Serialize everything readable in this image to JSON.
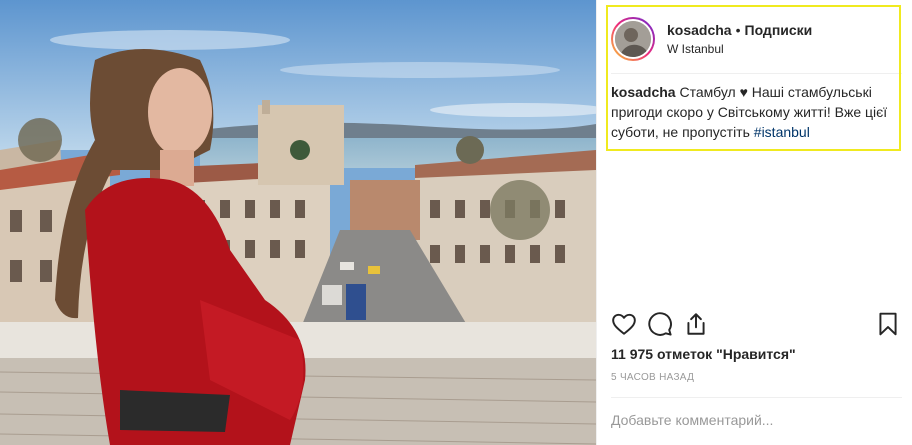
{
  "post": {
    "header": {
      "username": "kosadcha",
      "separator": "•",
      "follow_label": "Подписки",
      "location": "W Istanbul"
    },
    "caption": {
      "username": "kosadcha",
      "text": "Стамбул ♥ Наші стамбульські пригоди скоро у Світському житті! Вже цієї суботи, не пропустіть ",
      "hashtag": "#istanbul"
    },
    "actions": {
      "like_icon": "heart-icon",
      "comment_icon": "speech-bubble-icon",
      "share_icon": "share-icon",
      "save_icon": "bookmark-icon"
    },
    "likes_label": "11 975 отметок \"Нравится\"",
    "timestamp": "5 часов назад",
    "comment_placeholder": "Добавьте комментарий...",
    "colors": {
      "highlight_border": "#f0ea1f",
      "text": "#262626",
      "muted": "#999999",
      "hashtag": "#003569",
      "dress": "#b3121b"
    }
  }
}
